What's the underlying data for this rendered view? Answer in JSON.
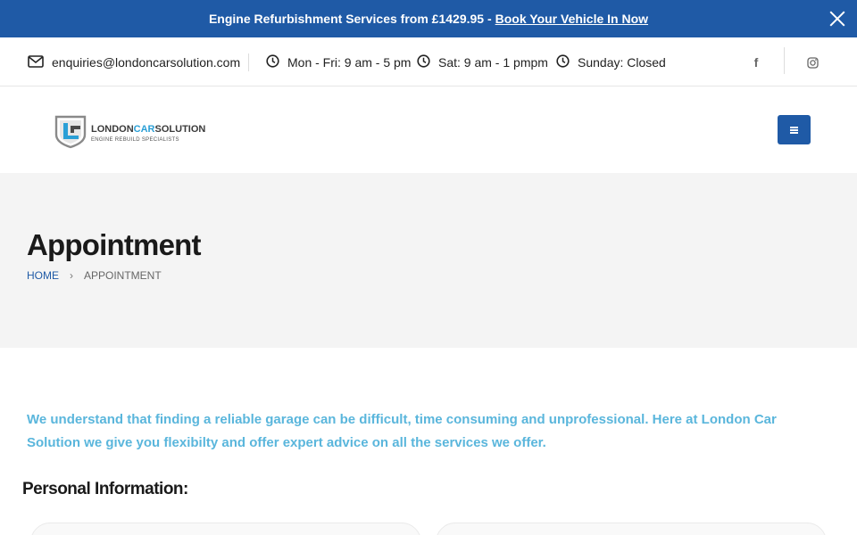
{
  "promo": {
    "text": "Engine Refurbishment Services from £1429.95 - ",
    "link_label": "Book Your Vehicle In Now"
  },
  "contact": {
    "email": "enquiries@londoncarsolution.com",
    "weekday_hours": "Mon - Fri: 9 am - 5 pm",
    "saturday_hours": "Sat: 9 am - 1 pmpm",
    "sunday_hours": "Sunday: Closed"
  },
  "social": {
    "facebook_glyph": "f"
  },
  "logo": {
    "name_part1": "LONDON",
    "name_part2": "CAR",
    "name_part3": "SOLUTION",
    "tagline": "ENGINE REBUILD SPECIALISTS",
    "accent_color": "#2a9fd6"
  },
  "page": {
    "title": "Appointment",
    "breadcrumb": {
      "home": "HOME",
      "separator": "›",
      "current": "APPOINTMENT"
    }
  },
  "intro": {
    "text": "We understand that finding a reliable garage can be difficult, time consuming and unprofessional. Here at London Car Solution we give you flexibilty and offer expert advice on all the services we offer."
  },
  "form": {
    "section_heading": "Personal Information:"
  },
  "colors": {
    "brand_blue": "#1f5aa6",
    "intro_text": "#5ab6dc",
    "band_bg": "#f4f4f4"
  }
}
